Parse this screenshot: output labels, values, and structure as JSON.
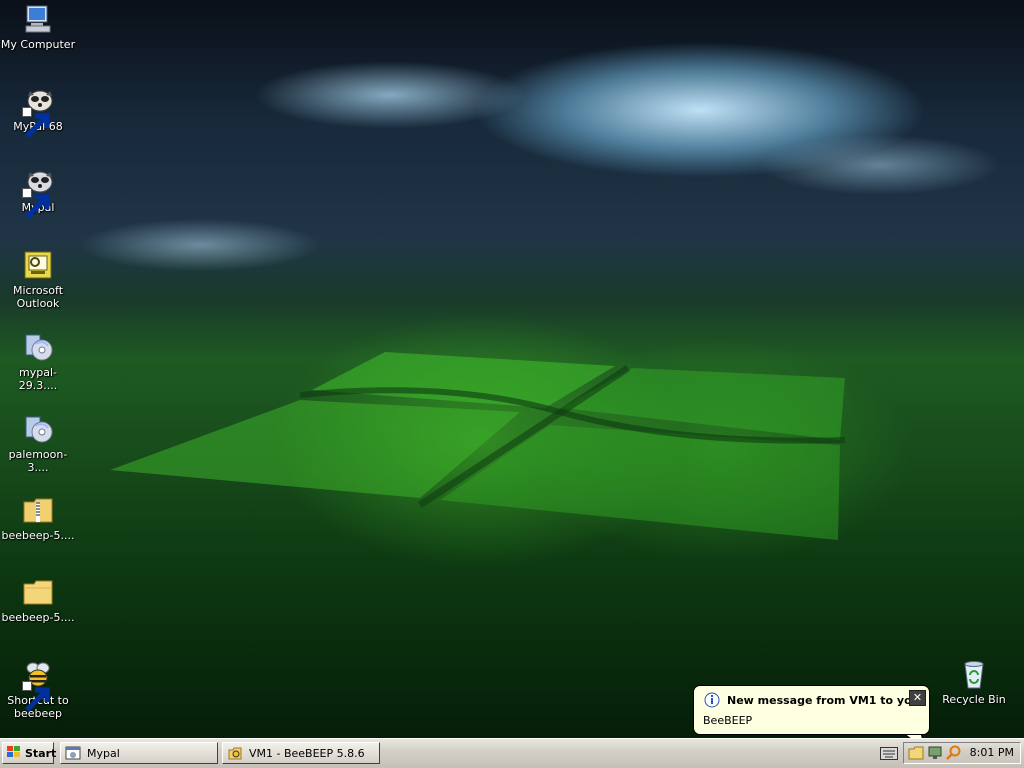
{
  "desktop_icons": [
    {
      "label": "My Computer",
      "icon": "computer-icon"
    },
    {
      "label": "MyPal 68",
      "icon": "raccoon-icon"
    },
    {
      "label": "Mypal",
      "icon": "raccoon-icon"
    },
    {
      "label": "Microsoft Outlook",
      "icon": "outlook-icon"
    },
    {
      "label": "mypal-29.3....",
      "icon": "installer-icon"
    },
    {
      "label": "palemoon-3....",
      "icon": "installer-icon"
    },
    {
      "label": "beebeep-5....",
      "icon": "zip-folder-icon"
    },
    {
      "label": "beebeep-5....",
      "icon": "folder-icon"
    },
    {
      "label": "Shortcut to beebeep",
      "icon": "bee-icon"
    },
    {
      "label": "Recycle Bin",
      "icon": "recycle-bin-icon"
    }
  ],
  "taskbar": {
    "start_label": "Start",
    "tasks": [
      {
        "label": "Mypal",
        "icon": "browser-icon"
      },
      {
        "label": "VM1 - BeeBEEP 5.8.6",
        "icon": "beebeep-icon"
      }
    ],
    "clock": "8:01 PM"
  },
  "notification": {
    "title": "New message from VM1 to you",
    "body": "BeeBEEP"
  },
  "colors": {
    "balloon_bg": "#ffffe1",
    "taskbar_bg": "#d4d0c8"
  }
}
